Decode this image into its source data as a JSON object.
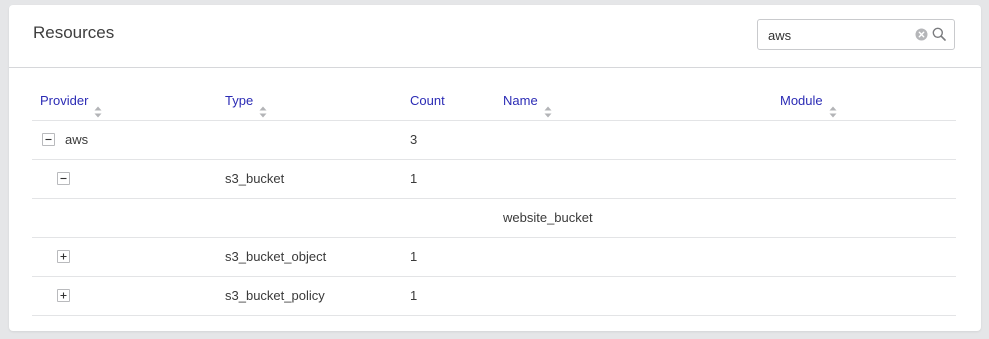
{
  "header": {
    "title": "Resources"
  },
  "search": {
    "value": "aws",
    "clear_icon": "clear-circle-icon",
    "search_icon": "magnifier-icon"
  },
  "table": {
    "columns": [
      {
        "key": "provider",
        "label": "Provider",
        "sortable": true
      },
      {
        "key": "type",
        "label": "Type",
        "sortable": true
      },
      {
        "key": "count",
        "label": "Count",
        "sortable": false
      },
      {
        "key": "name",
        "label": "Name",
        "sortable": true
      },
      {
        "key": "module",
        "label": "Module",
        "sortable": true
      }
    ],
    "rows": [
      {
        "provider": "aws",
        "type": "",
        "count": "3",
        "name": "",
        "module": "",
        "toggle": "collapse",
        "level": 0
      },
      {
        "provider": "",
        "type": "s3_bucket",
        "count": "1",
        "name": "",
        "module": "",
        "toggle": "collapse",
        "level": 1
      },
      {
        "provider": "",
        "type": "",
        "count": "",
        "name": "website_bucket",
        "module": "",
        "toggle": "none",
        "level": 2
      },
      {
        "provider": "",
        "type": "s3_bucket_object",
        "count": "1",
        "name": "",
        "module": "",
        "toggle": "expand",
        "level": 1
      },
      {
        "provider": "",
        "type": "s3_bucket_policy",
        "count": "1",
        "name": "",
        "module": "",
        "toggle": "expand",
        "level": 1
      }
    ]
  },
  "colors": {
    "header_link": "#2b2bb5",
    "text": "#3a3a3a",
    "border": "#e3e4e6",
    "background": "#e5e6e8"
  }
}
